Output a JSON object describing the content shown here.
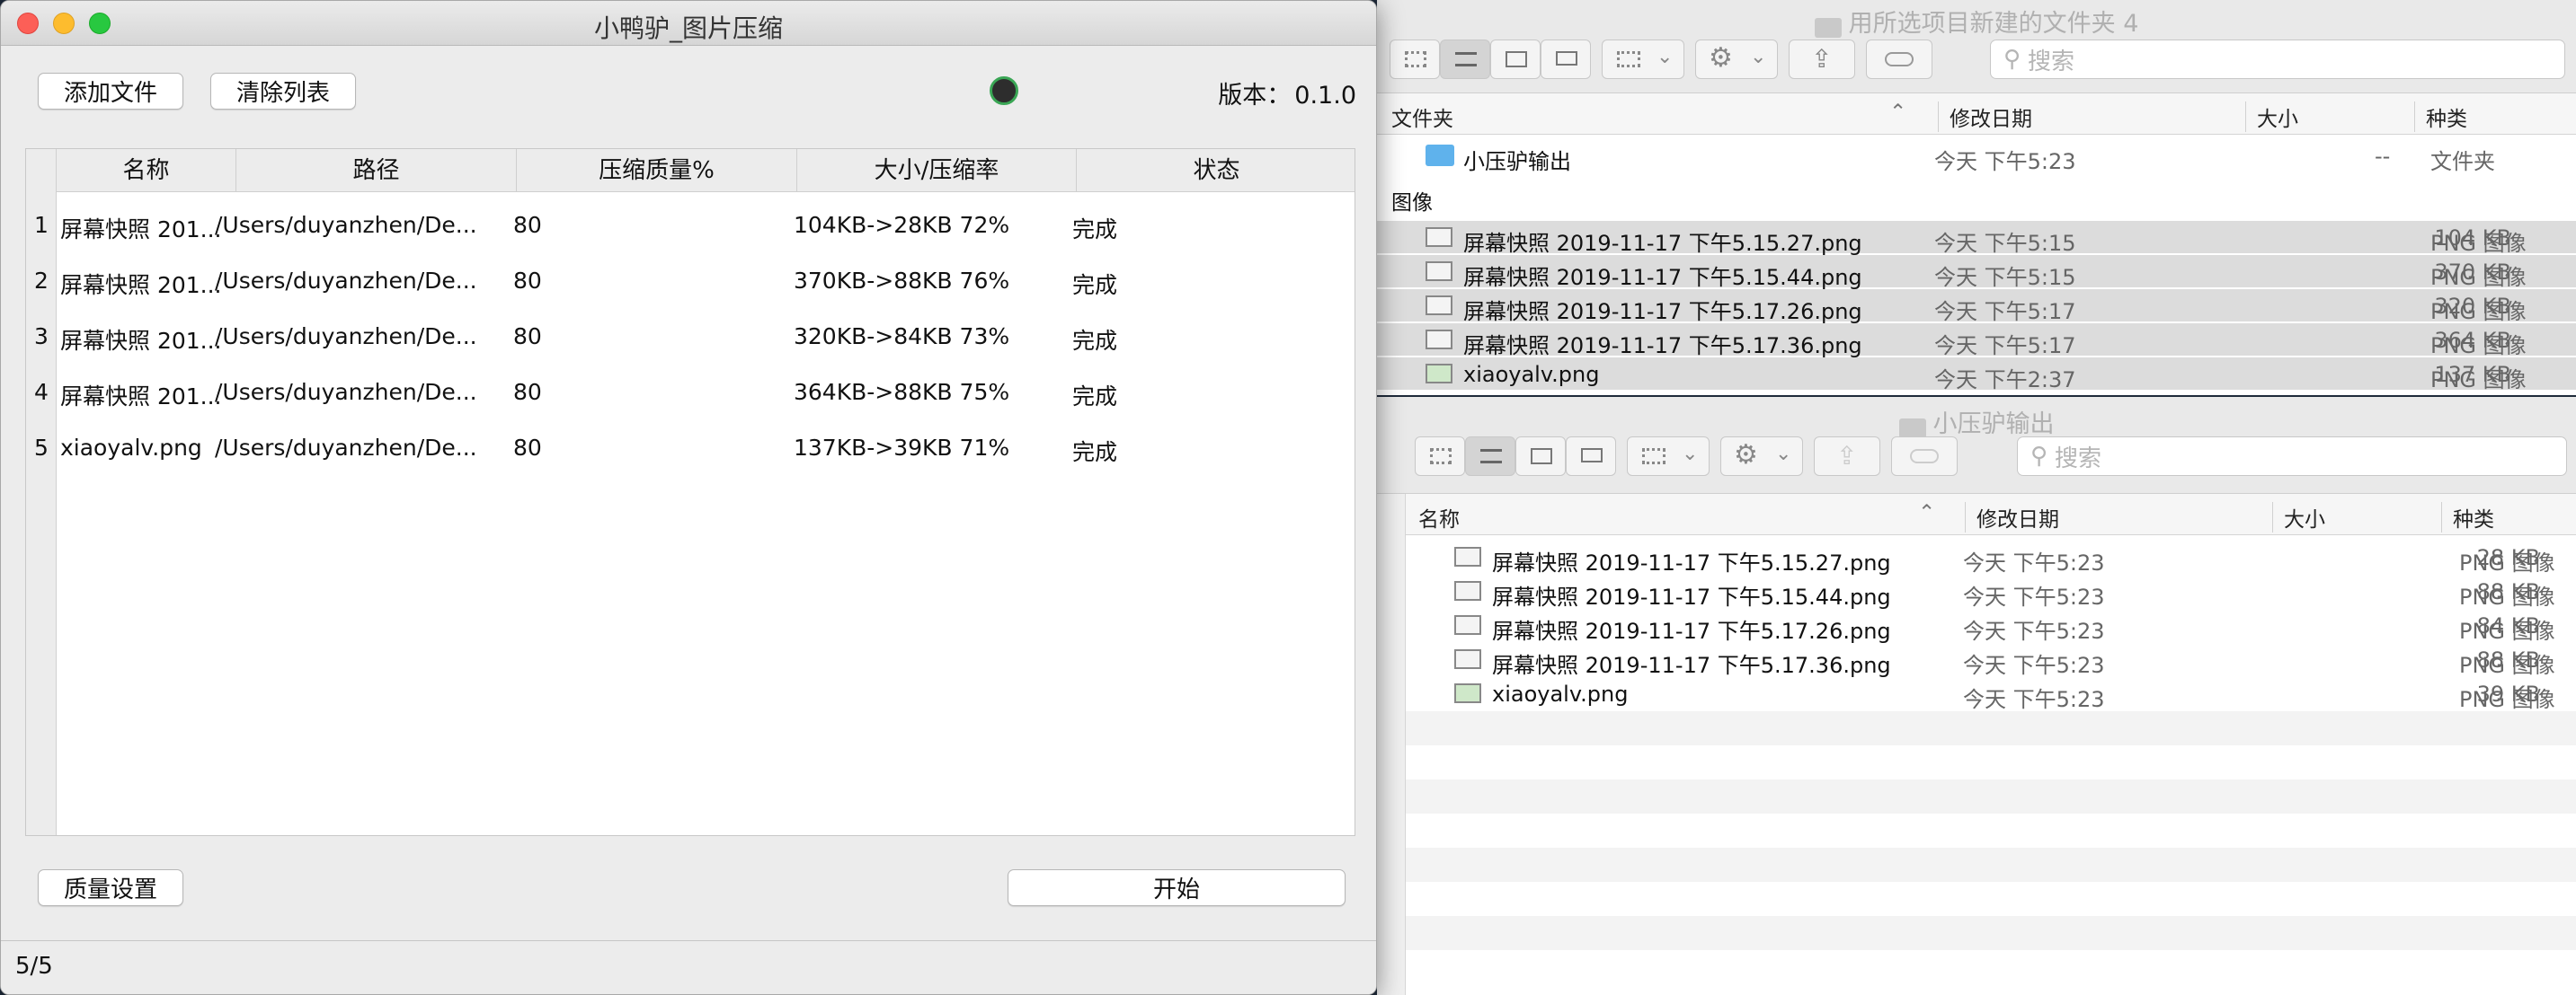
{
  "app": {
    "title": "小鸭驴_图片压缩",
    "add_files": "添加文件",
    "clear_list": "清除列表",
    "version_label": "版本：",
    "version": "0.1.0",
    "quality_settings": "质量设置",
    "start": "开始",
    "status_text": "5/5",
    "columns": [
      "名称",
      "路径",
      "压缩质量%",
      "大小/压缩率",
      "状态"
    ],
    "rows": [
      {
        "num": "1",
        "name": "屏幕快照 201...",
        "path": "/Users/duyanzhen/De...",
        "quality": "80",
        "size": "104KB->28KB  72%",
        "status": "完成"
      },
      {
        "num": "2",
        "name": "屏幕快照 201...",
        "path": "/Users/duyanzhen/De...",
        "quality": "80",
        "size": "370KB->88KB  76%",
        "status": "完成"
      },
      {
        "num": "3",
        "name": "屏幕快照 201...",
        "path": "/Users/duyanzhen/De...",
        "quality": "80",
        "size": "320KB->84KB  73%",
        "status": "完成"
      },
      {
        "num": "4",
        "name": "屏幕快照 201...",
        "path": "/Users/duyanzhen/De...",
        "quality": "80",
        "size": "364KB->88KB  75%",
        "status": "完成"
      },
      {
        "num": "5",
        "name": "xiaoyalv.png",
        "path": "/Users/duyanzhen/De...",
        "quality": "80",
        "size": "137KB->39KB  71%",
        "status": "完成"
      }
    ]
  },
  "finder_top": {
    "title": "用所选项目新建的文件夹 4",
    "search_placeholder": "搜索",
    "columns": {
      "name": "文件夹",
      "date": "修改日期",
      "size": "大小",
      "kind": "种类"
    },
    "folder": {
      "name": "小压驴输出",
      "date": "今天 下午5:23",
      "size": "--",
      "kind": "文件夹"
    },
    "group_label": "图像",
    "files": [
      {
        "name": "屏幕快照 2019-11-17 下午5.15.27.png",
        "date": "今天 下午5:15",
        "size": "104 KB",
        "kind": "PNG 图像"
      },
      {
        "name": "屏幕快照 2019-11-17 下午5.15.44.png",
        "date": "今天 下午5:15",
        "size": "370 KB",
        "kind": "PNG 图像"
      },
      {
        "name": "屏幕快照 2019-11-17 下午5.17.26.png",
        "date": "今天 下午5:17",
        "size": "320 KB",
        "kind": "PNG 图像"
      },
      {
        "name": "屏幕快照 2019-11-17 下午5.17.36.png",
        "date": "今天 下午5:17",
        "size": "364 KB",
        "kind": "PNG 图像"
      },
      {
        "name": "xiaoyalv.png",
        "date": "今天 下午2:37",
        "size": "137 KB",
        "kind": "PNG 图像"
      }
    ]
  },
  "finder_bottom": {
    "title": "小压驴输出",
    "search_placeholder": "搜索",
    "columns": {
      "name": "名称",
      "date": "修改日期",
      "size": "大小",
      "kind": "种类"
    },
    "files": [
      {
        "name": "屏幕快照 2019-11-17 下午5.15.27.png",
        "date": "今天 下午5:23",
        "size": "28 KB",
        "kind": "PNG 图像"
      },
      {
        "name": "屏幕快照 2019-11-17 下午5.15.44.png",
        "date": "今天 下午5:23",
        "size": "88 KB",
        "kind": "PNG 图像"
      },
      {
        "name": "屏幕快照 2019-11-17 下午5.17.26.png",
        "date": "今天 下午5:23",
        "size": "84 KB",
        "kind": "PNG 图像"
      },
      {
        "name": "屏幕快照 2019-11-17 下午5.17.36.png",
        "date": "今天 下午5:23",
        "size": "88 KB",
        "kind": "PNG 图像"
      },
      {
        "name": "xiaoyalv.png",
        "date": "今天 下午5:23",
        "size": "39 KB",
        "kind": "PNG 图像"
      }
    ]
  },
  "colors": {
    "close": "#fc5f57",
    "minimize": "#fdbc2e",
    "zoom": "#28c840",
    "folder": "#5fb2ec"
  }
}
